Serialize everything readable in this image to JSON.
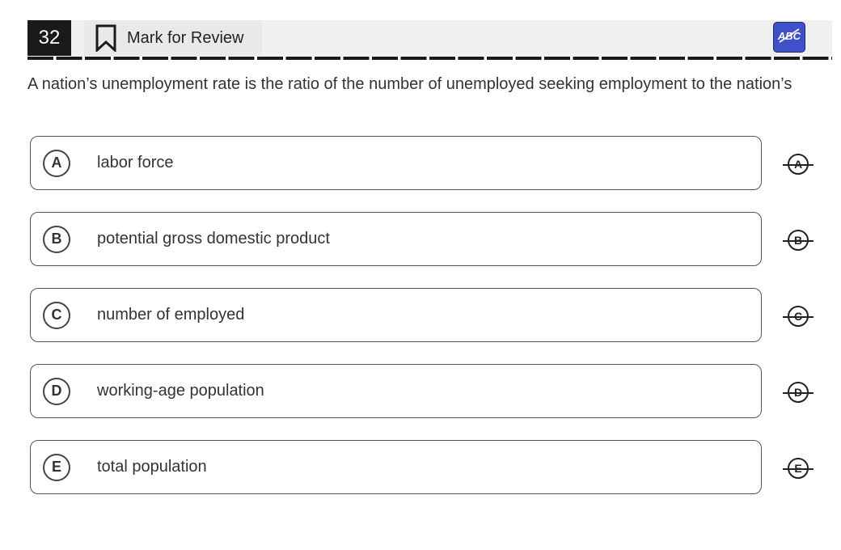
{
  "header": {
    "question_number": "32",
    "mark_for_review_label": "Mark for Review",
    "icons": {
      "bookmark": "bookmark-icon",
      "abc_crossout": "abc-crossout-icon"
    },
    "accent_color": "#3f51c8"
  },
  "question": {
    "text": "A nation’s unemployment rate is the ratio of the number of unemployed seeking employment to the nation’s"
  },
  "choices": [
    {
      "letter": "A",
      "text": "labor force"
    },
    {
      "letter": "B",
      "text": "potential gross domestic product"
    },
    {
      "letter": "C",
      "text": "number of employed"
    },
    {
      "letter": "D",
      "text": "working-age population"
    },
    {
      "letter": "E",
      "text": "total population"
    }
  ]
}
